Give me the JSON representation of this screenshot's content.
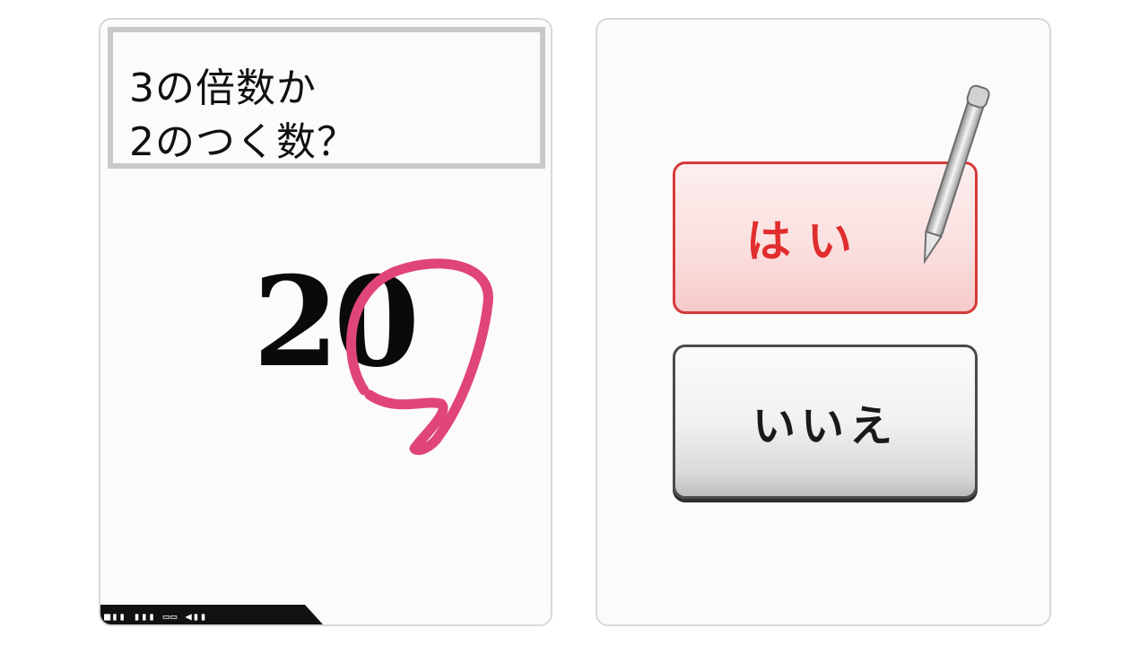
{
  "question": {
    "line1": "3の倍数か",
    "line2": "2のつく数？"
  },
  "number": "20",
  "buttons": {
    "yes_label": "はい",
    "no_label": "いいえ"
  },
  "status_bar": {
    "text": "■▮▮ ▮▮▮ ▭▭ ◀▮▮"
  },
  "colors": {
    "circle_mark": "#e0457a",
    "yes_text": "#e02d2d",
    "yes_border": "#d63a3a",
    "no_border": "#4a4a4a"
  },
  "icons": {
    "circle_mark": "handwritten-circle-icon",
    "stylus": "stylus-icon"
  }
}
